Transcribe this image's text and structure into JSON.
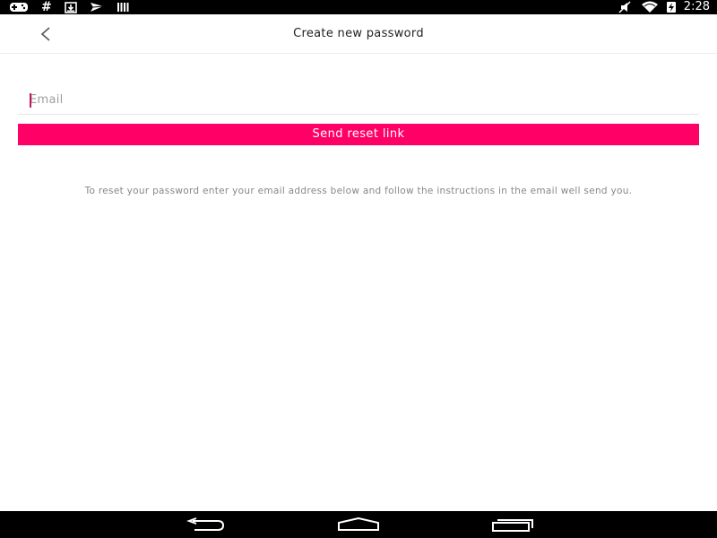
{
  "status_bar": {
    "left_icons": [
      "gamepad-icon",
      "hash-icon",
      "download-icon",
      "mail-fly-icon",
      "barcode-icon"
    ],
    "hash_glyph": "#",
    "right_icons": [
      "muted-icon",
      "wifi-icon",
      "battery-charging-icon"
    ],
    "time": "2:28"
  },
  "app_bar": {
    "back_icon": "chevron-left-icon",
    "title": "Create new password"
  },
  "form": {
    "email_placeholder": "Email",
    "email_value": "",
    "send_label": "Send reset link",
    "instructions": "To reset your password enter your email address below and follow the instructions in the email well send you."
  },
  "nav_bar": {
    "buttons": [
      "back-icon",
      "home-icon",
      "recents-icon"
    ]
  },
  "colors": {
    "accent": "#ff0066",
    "caret": "#c2185b",
    "status_bar": "#000000"
  }
}
